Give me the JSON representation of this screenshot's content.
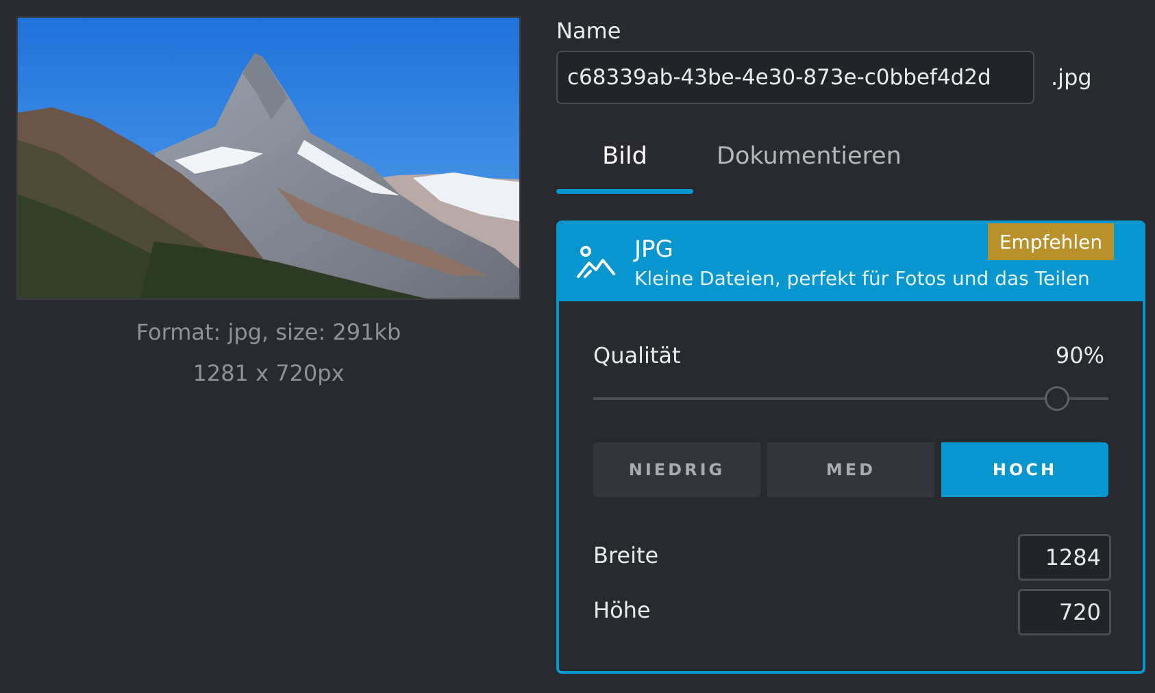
{
  "preview": {
    "format_line": "Format: jpg, size: 291kb",
    "dimensions_line": "1281 x 720px"
  },
  "name_section": {
    "label": "Name",
    "value": "c68339ab-43be-4e30-873e-c0bbef4d2d",
    "extension": ".jpg"
  },
  "tabs": [
    {
      "label": "Bild",
      "active": true
    },
    {
      "label": "Dokumentieren",
      "active": false
    }
  ],
  "format_card": {
    "icon": "image-icon",
    "title": "JPG",
    "description": "Kleine Dateien, perfekt für Fotos und das Teilen",
    "badge": "Empfehlen",
    "accent_color": "#0896cf",
    "badge_color": "#b8912b"
  },
  "quality": {
    "label": "Qualität",
    "value_text": "90%",
    "value": 0.9
  },
  "presets": [
    {
      "label": "NIEDRIG",
      "selected": false
    },
    {
      "label": "MED",
      "selected": false
    },
    {
      "label": "HOCH",
      "selected": true
    }
  ],
  "dimensions": {
    "width_label": "Breite",
    "width_value": "1284",
    "height_label": "Höhe",
    "height_value": "720"
  }
}
